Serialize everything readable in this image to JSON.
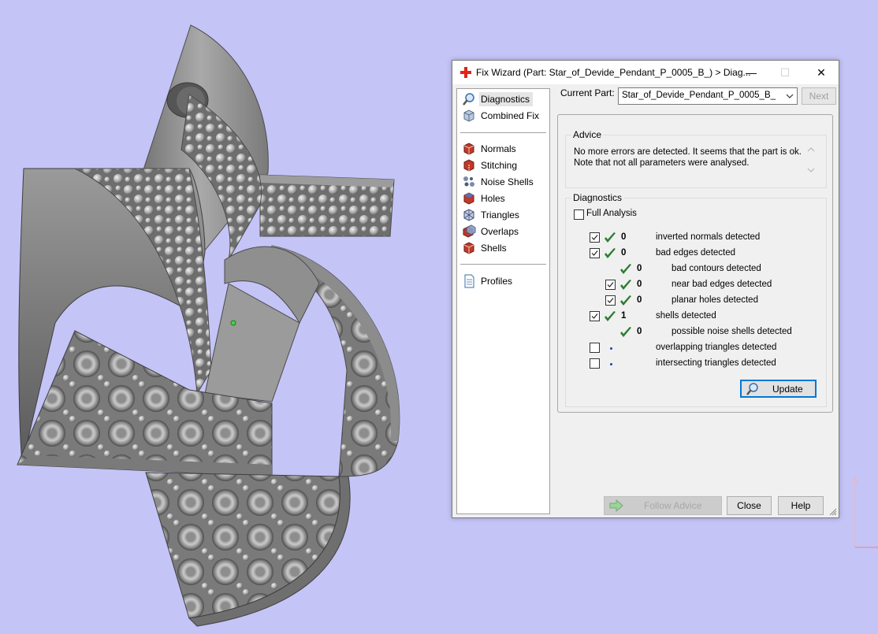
{
  "window": {
    "title": "Fix Wizard (Part: Star_of_Devide_Pendant_P_0005_B_) > Diag...",
    "minimize": "—",
    "maximize": "☐",
    "close": "✕"
  },
  "nav": {
    "items": [
      {
        "label": "Diagnostics",
        "icon": "magnifier-icon",
        "selected": true
      },
      {
        "label": "Combined Fix",
        "icon": "box-icon"
      },
      {
        "label": "Normals",
        "icon": "normals-icon"
      },
      {
        "label": "Stitching",
        "icon": "stitching-icon"
      },
      {
        "label": "Noise Shells",
        "icon": "noise-shells-icon"
      },
      {
        "label": "Holes",
        "icon": "holes-icon"
      },
      {
        "label": "Triangles",
        "icon": "triangles-icon"
      },
      {
        "label": "Overlaps",
        "icon": "overlaps-icon"
      },
      {
        "label": "Shells",
        "icon": "shells-icon"
      },
      {
        "label": "Profiles",
        "icon": "document-icon"
      }
    ]
  },
  "current_part": {
    "label": "Current Part:",
    "value": "Star_of_Devide_Pendant_P_0005_B_",
    "next_label": "Next"
  },
  "advice": {
    "title": "Advice",
    "text": "No more errors are detected. It seems that the part is ok.\nNote that not all parameters were analysed."
  },
  "diagnostics": {
    "title": "Diagnostics",
    "full_analysis_label": "Full Analysis",
    "full_analysis_checked": false,
    "rows": [
      {
        "checkbox": true,
        "checked": true,
        "status": "ok",
        "count": "0",
        "label": "inverted normals detected",
        "indent": 0
      },
      {
        "checkbox": true,
        "checked": true,
        "status": "ok",
        "count": "0",
        "label": "bad edges detected",
        "indent": 0
      },
      {
        "checkbox": false,
        "checked": false,
        "status": "ok",
        "count": "0",
        "label": "bad contours detected",
        "indent": 1
      },
      {
        "checkbox": true,
        "checked": true,
        "status": "ok",
        "count": "0",
        "label": "near bad edges detected",
        "indent": 1
      },
      {
        "checkbox": true,
        "checked": true,
        "status": "ok",
        "count": "0",
        "label": "planar holes detected",
        "indent": 1
      },
      {
        "checkbox": true,
        "checked": true,
        "status": "ok",
        "count": "1",
        "label": "shells detected",
        "indent": 0
      },
      {
        "checkbox": false,
        "checked": false,
        "status": "ok",
        "count": "0",
        "label": "possible noise shells detected",
        "indent": 1
      },
      {
        "checkbox": true,
        "checked": false,
        "status": "pending",
        "count": "",
        "label": "overlapping triangles detected",
        "indent": 0
      },
      {
        "checkbox": true,
        "checked": false,
        "status": "pending",
        "count": "",
        "label": "intersecting triangles detected",
        "indent": 0
      }
    ],
    "update_label": "Update"
  },
  "footer": {
    "follow_advice_label": "Follow Advice",
    "close_label": "Close",
    "help_label": "Help"
  },
  "colors": {
    "viewport_bg": "#c4c4f7",
    "tick_green": "#2e7d32",
    "accent_blue": "#0078d7"
  }
}
